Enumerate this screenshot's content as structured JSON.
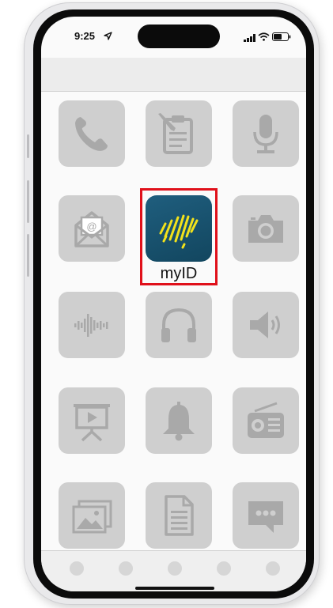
{
  "status_bar": {
    "time": "9:25",
    "icons": [
      "location-arrow-icon",
      "cellular-signal-icon",
      "wifi-icon",
      "battery-icon"
    ]
  },
  "apps": [
    {
      "icon": "phone-icon"
    },
    {
      "icon": "clipboard-pencil-icon"
    },
    {
      "icon": "microphone-icon"
    },
    {
      "icon": "email-icon"
    },
    {
      "name": "myID",
      "icon": "myid-australia-icon",
      "highlighted": true
    },
    {
      "icon": "camera-icon"
    },
    {
      "icon": "sound-wave-icon"
    },
    {
      "icon": "headphones-icon"
    },
    {
      "icon": "speaker-icon"
    },
    {
      "icon": "presentation-icon"
    },
    {
      "icon": "bell-icon"
    },
    {
      "icon": "radio-icon"
    },
    {
      "icon": "photos-icon"
    },
    {
      "icon": "document-icon"
    },
    {
      "icon": "chat-icon"
    }
  ],
  "dock": {
    "page_dots": 5
  },
  "colors": {
    "tile": "#cfcfcf",
    "glyph": "#a9a9a9",
    "myid_bg": "#1a5573",
    "myid_accent": "#f2e21b",
    "highlight": "#e0101a"
  }
}
